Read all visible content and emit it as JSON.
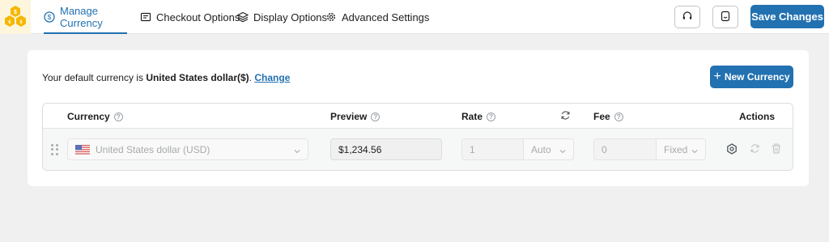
{
  "header": {
    "logo_alt": "app-logo",
    "tabs": [
      {
        "label": "Manage Currency",
        "icon": "dollar-circle-icon",
        "active": true
      },
      {
        "label": "Checkout Options",
        "icon": "receipt-icon",
        "active": false
      },
      {
        "label": "Display Options",
        "icon": "layers-icon",
        "active": false
      },
      {
        "label": "Advanced Settings",
        "icon": "gear-icon",
        "active": false
      }
    ],
    "support_icon": "headset-icon",
    "docs_icon": "document-icon",
    "save_label": "Save Changes"
  },
  "main": {
    "default_prefix": "Your default currency is",
    "default_currency": "United States dollar($)",
    "default_suffix": ".",
    "change_label": "Change",
    "new_currency_label": "New Currency",
    "table": {
      "headers": {
        "currency": "Currency",
        "preview": "Preview",
        "rate": "Rate",
        "fee": "Fee",
        "actions": "Actions"
      },
      "row": {
        "currency": "United States dollar (USD)",
        "preview": "$1,234.56",
        "rate_value": "1",
        "rate_mode": "Auto",
        "fee_value": "0",
        "fee_mode": "Fixed"
      }
    }
  },
  "colors": {
    "accent": "#2271b1",
    "background": "#f0f0f1"
  }
}
